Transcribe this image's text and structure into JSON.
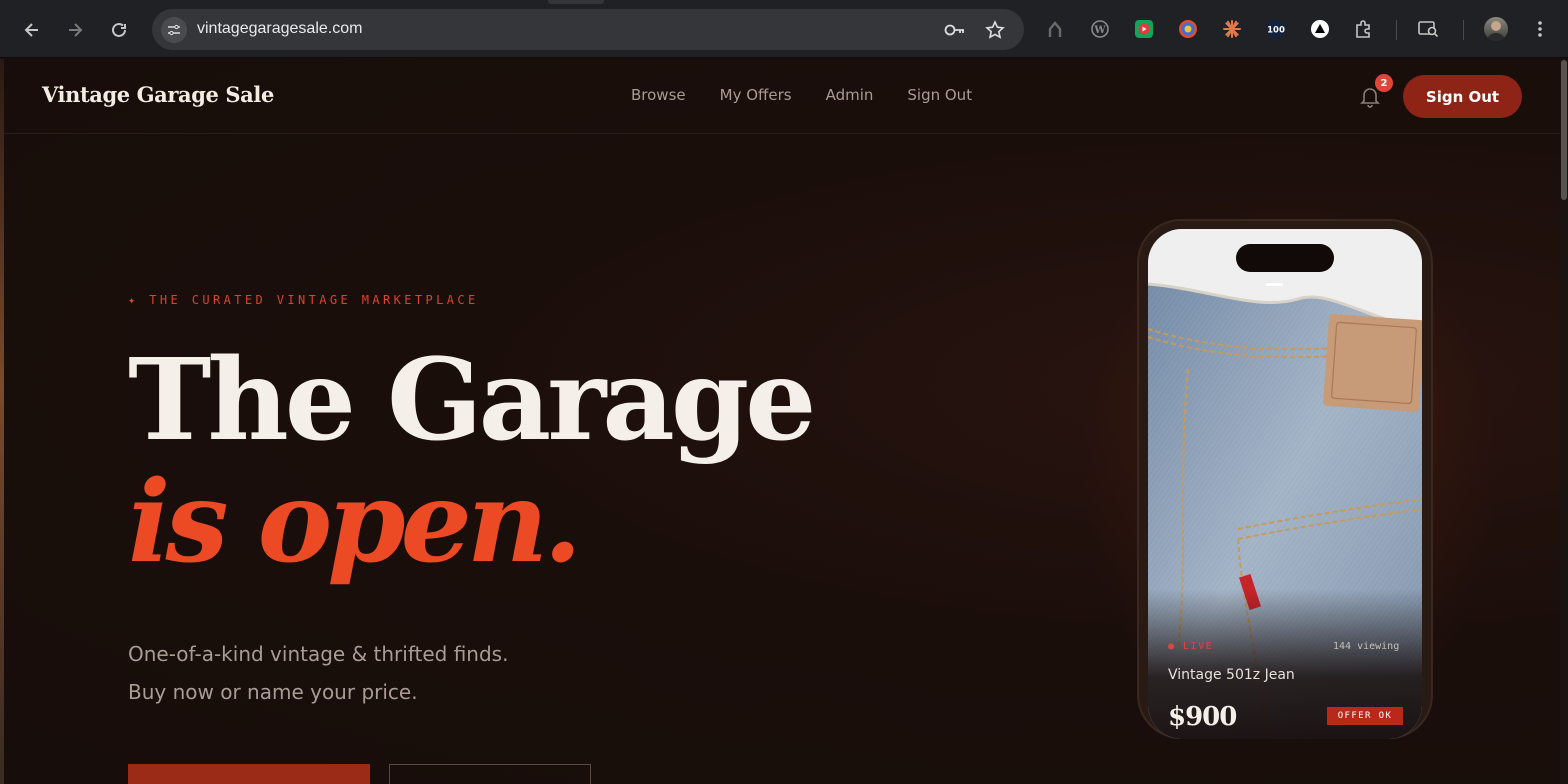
{
  "browser": {
    "url": "vintagegaragesale.com",
    "extensions": [
      "home-icon",
      "wordpress-icon",
      "video-extension-icon",
      "color-picker-icon",
      "claude-icon",
      "100-badge-icon",
      "triangle-icon",
      "puzzle-icon",
      "tab-search-icon",
      "avatar"
    ],
    "ext_100_label": "100"
  },
  "nav": {
    "brand": "Vintage Garage Sale",
    "links": [
      "Browse",
      "My Offers",
      "Admin",
      "Sign Out"
    ],
    "notification_count": "2",
    "signout_label": "Sign Out"
  },
  "hero": {
    "eyebrow": "✦ THE CURATED VINTAGE MARKETPLACE",
    "title_line1": "The Garage",
    "title_line2": "is open.",
    "subtitle_line1": "One-of-a-kind vintage & thrifted finds.",
    "subtitle_line2": "Buy now or name your price."
  },
  "phone_card": {
    "live_label": "● LIVE",
    "viewing": "144 viewing",
    "item_name": "Vintage 501z Jean",
    "price": "$900",
    "offer_tag": "OFFER OK"
  },
  "colors": {
    "accent": "#ec4a25",
    "button": "#8e2416",
    "background": "#1a0e0b"
  }
}
